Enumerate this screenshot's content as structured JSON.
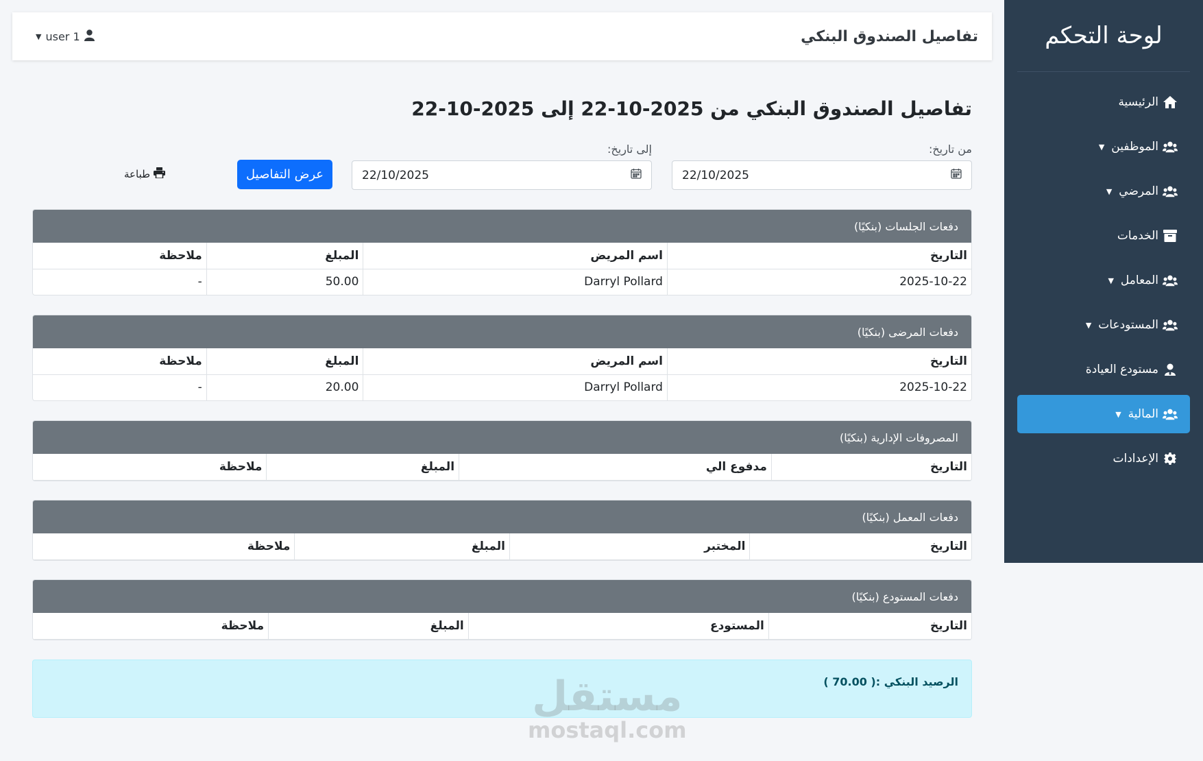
{
  "sidebar": {
    "title": "لوحة التحكم",
    "items": [
      {
        "label": "الرئيسية",
        "icon": "home-icon",
        "dropdown": false
      },
      {
        "label": "الموظفين",
        "icon": "users-icon",
        "dropdown": true
      },
      {
        "label": "المرضي",
        "icon": "users-icon",
        "dropdown": true
      },
      {
        "label": "الخدمات",
        "icon": "box-icon",
        "dropdown": false
      },
      {
        "label": "المعامل",
        "icon": "users-icon",
        "dropdown": true
      },
      {
        "label": "المستودعات",
        "icon": "users-icon",
        "dropdown": true
      },
      {
        "label": "مستودع العيادة",
        "icon": "user-tie-icon",
        "dropdown": false
      },
      {
        "label": "المالية",
        "icon": "users-icon",
        "dropdown": true,
        "active": true
      },
      {
        "label": "الإعدادات",
        "icon": "gear-icon",
        "dropdown": false
      }
    ]
  },
  "topbar": {
    "title": "تفاصيل الصندوق البنكي",
    "user": "user 1"
  },
  "page_title": "تفاصيل الصندوق البنكي من 2025-10-22 إلى 2025-10-22",
  "filters": {
    "from_label": "من تاريخ:",
    "from_value": "22/10/2025",
    "to_label": "إلى تاريخ:",
    "to_value": "22/10/2025",
    "show_button": "عرض التفاصيل",
    "print_label": "طباعة"
  },
  "sections": {
    "sessions": {
      "title": "دفعات الجلسات (بنكيًا)",
      "headers": [
        "التاريخ",
        "اسم المريض",
        "المبلغ",
        "ملاحظة"
      ],
      "rows": [
        [
          "2025-10-22",
          "Darryl Pollard",
          "50.00",
          "-"
        ]
      ]
    },
    "patients": {
      "title": "دفعات المرضى (بنكيًا)",
      "headers": [
        "التاريخ",
        "اسم المريض",
        "المبلغ",
        "ملاحظة"
      ],
      "rows": [
        [
          "2025-10-22",
          "Darryl Pollard",
          "20.00",
          "-"
        ]
      ]
    },
    "admin": {
      "title": "المصروفات الإدارية (بنكيًا)",
      "headers": [
        "التاريخ",
        "مدفوع الي",
        "المبلغ",
        "ملاحظة"
      ],
      "rows": []
    },
    "lab": {
      "title": "دفعات المعمل (بنكيًا)",
      "headers": [
        "التاريخ",
        "المختبر",
        "المبلغ",
        "ملاحظة"
      ],
      "rows": []
    },
    "warehouse": {
      "title": "دفعات المستودع (بنكيًا)",
      "headers": [
        "التاريخ",
        "المستودع",
        "المبلغ",
        "ملاحظة"
      ],
      "rows": []
    }
  },
  "balance": "الرصيد البنكي :( 70.00 )",
  "watermark": {
    "arabic": "مستقل",
    "latin": "mostaql.com"
  }
}
